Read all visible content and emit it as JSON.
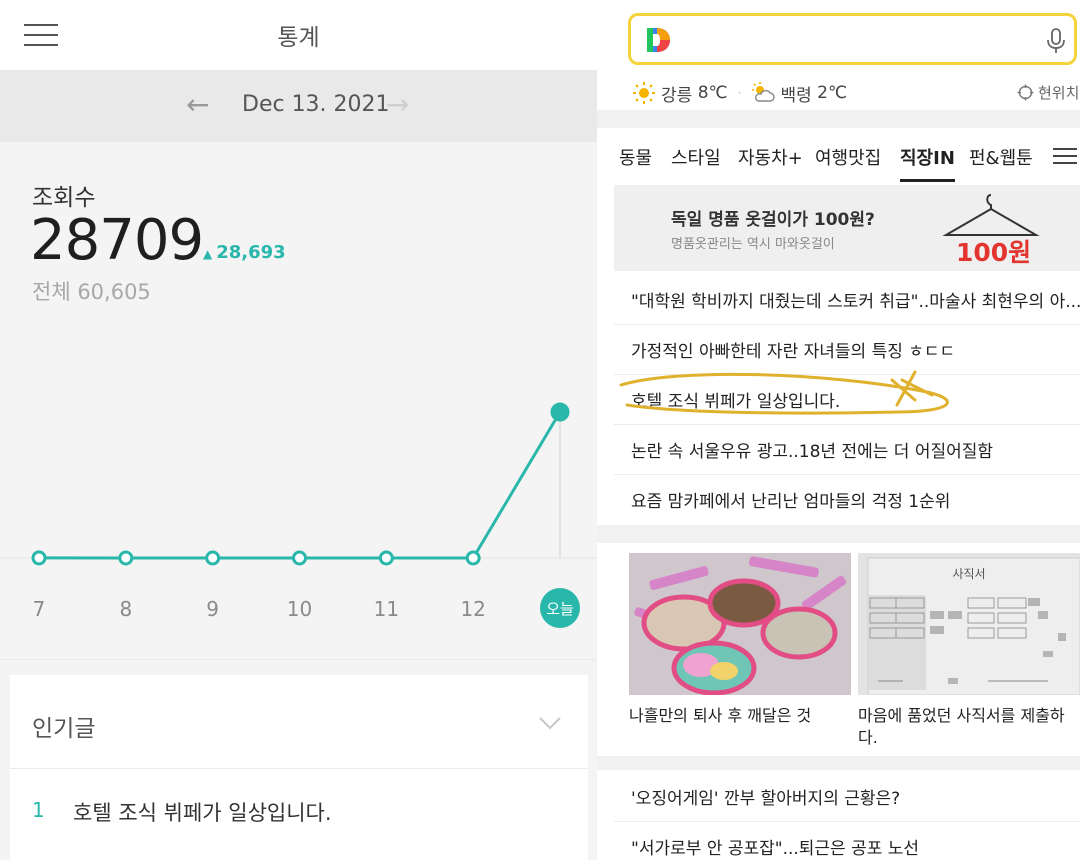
{
  "left": {
    "header": {
      "title": "통계",
      "menu_icon": "hamburger-icon"
    },
    "date_nav": {
      "date": "Dec 13. 2021",
      "prev_icon": "arrow-left-icon",
      "next_icon": "arrow-right-icon"
    },
    "stats": {
      "label": "조회수",
      "count": "28709",
      "delta": "28,693",
      "total": "전체 60,605"
    },
    "chart_data": {
      "type": "line",
      "categories": [
        "7",
        "8",
        "9",
        "10",
        "11",
        "12",
        "오늘"
      ],
      "series": [
        {
          "values": [
            16,
            0,
            0,
            0,
            0,
            0,
            28709
          ]
        }
      ],
      "highlight_category": "오늘",
      "color": "#2ab7ab"
    },
    "popular": {
      "title": "인기글",
      "items": [
        {
          "rank": "1",
          "title": "호텔 조식 뷔페가 일상입니다."
        }
      ]
    }
  },
  "right": {
    "search": {
      "logo": "daum-logo",
      "mic_icon": "mic-icon",
      "accent": "#f5d33a"
    },
    "weather": [
      {
        "city": "강릉",
        "temp": "8℃",
        "icon": "sun-icon"
      },
      {
        "city": "백령",
        "temp": "2℃",
        "icon": "cloud-sun-icon"
      }
    ],
    "location": "현위치",
    "tabs": [
      "동물",
      "스타일",
      "자동차+",
      "여행맛집",
      "직장IN",
      "펀&웹툰"
    ],
    "active_tab": "직장IN",
    "ad": {
      "title": "독일 명품 옷걸이가 100원?",
      "subtitle": "명품옷관리는 역시 마와옷걸이",
      "price": "100원"
    },
    "news": [
      "\"대학원 학비까지 대줬는데 스토커 취급\"..마술사 최현우의 아...",
      "가정적인 아빠한테 자란 자녀들의 특징 ㅎㄷㄷ",
      "호텔 조식 뷔페가 일상입니다.",
      "논란 속 서울우유 광고..18년 전에는 더 어질어질함",
      "요즘 맘카페에서 난리난 엄마들의 걱정 1순위"
    ],
    "cards": [
      {
        "caption": "나흘만의 퇴사 후 깨달은 것"
      },
      {
        "caption": "마음에 품었던 사직서를 제출하다.",
        "doc_title": "사직서"
      }
    ],
    "bottom_news": [
      "'오징어게임' 깐부 할아버지의 근황은?",
      "\"서가로부 안 공포잡\"...퇴근은 공포 노선"
    ]
  }
}
